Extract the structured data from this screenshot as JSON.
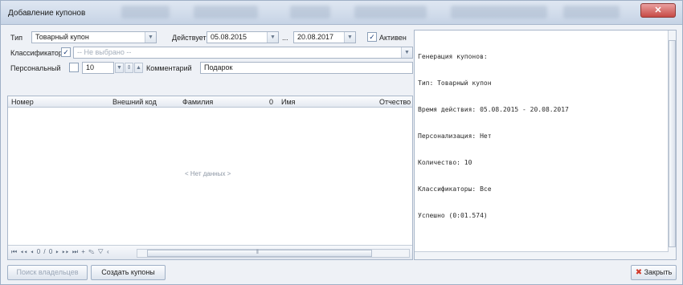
{
  "window": {
    "title": "Добавление купонов",
    "close_glyph": "✕"
  },
  "form": {
    "type_label": "Тип",
    "type_value": "Товарный купон",
    "valid_label": "Действует",
    "date_from": "05.08.2015",
    "date_separator": "...",
    "date_to": "20.08.2017",
    "active_label": "Активен",
    "classifier_label": "Классификатор",
    "classifier_value": "-- Не выбрано --",
    "personal_label": "Персональный",
    "quantity": "10",
    "comment_label": "Комментарий",
    "comment_value": "Подарок",
    "checkmark": "✓"
  },
  "grid": {
    "columns": [
      "Номер",
      "Внешний код",
      "Фамилия",
      "0",
      "Имя",
      "Отчество"
    ],
    "empty_text": "< Нет данных >",
    "nav_text": "⏮ ◂◂ ◂ 0 / 0 ▸ ▸▸ ⏭ + ✎ ▽ ‹",
    "scroll_mid": "‖"
  },
  "log": {
    "lines": [
      "Генерация купонов:",
      "Тип: Товарный купон",
      "Время действия: 05.08.2015 - 20.08.2017",
      "Персонализация: Нет",
      "Количество: 10",
      "Классификаторы: Все",
      "Успешно (0:01.574)"
    ]
  },
  "buttons": {
    "find_owner": "Поиск владельцев",
    "create": "Создать купоны",
    "close": "Закрыть",
    "close_icon_glyph": "✖"
  }
}
